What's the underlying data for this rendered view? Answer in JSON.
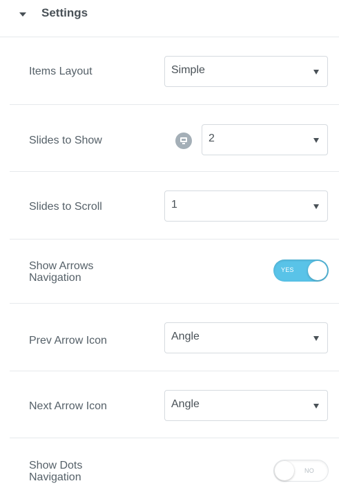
{
  "section": {
    "title": "Settings",
    "caret_icon": "caret-down-icon"
  },
  "controls": {
    "items_layout": {
      "label": "Items Layout",
      "value": "Simple"
    },
    "slides_to_show": {
      "label": "Slides to Show",
      "value": "2",
      "device_icon": "desktop-icon"
    },
    "slides_to_scroll": {
      "label": "Slides to Scroll",
      "value": "1"
    },
    "show_arrows": {
      "label": "Show Arrows Navigation",
      "toggle_text": "YES",
      "on": true
    },
    "prev_arrow_icon": {
      "label": "Prev Arrow Icon",
      "value": "Angle"
    },
    "next_arrow_icon": {
      "label": "Next Arrow Icon",
      "value": "Angle"
    },
    "show_dots": {
      "label": "Show Dots Navigation",
      "toggle_text": "NO",
      "on": false
    }
  },
  "colors": {
    "accent": "#59c3e8",
    "label": "#556068",
    "border": "#d5dadf",
    "divider": "#e6e9ec"
  }
}
